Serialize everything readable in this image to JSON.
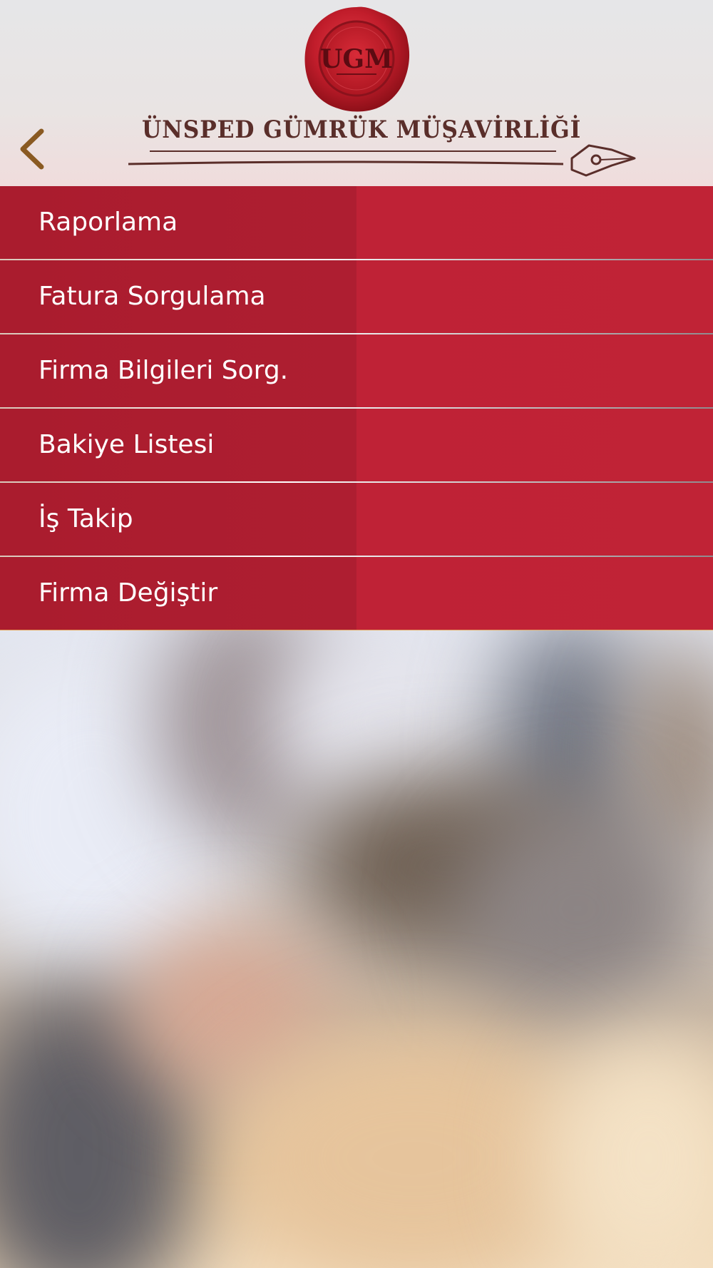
{
  "header": {
    "seal_text": "UGM",
    "brand_title": "ÜNSPED GÜMRÜK MÜŞAVİRLİĞİ"
  },
  "menu": {
    "items": [
      {
        "label": "Raporlama"
      },
      {
        "label": "Fatura Sorgulama"
      },
      {
        "label": "Firma Bilgileri Sorg."
      },
      {
        "label": "Bakiye Listesi"
      },
      {
        "label": "İş Takip"
      },
      {
        "label": "Firma Değiştir"
      }
    ]
  },
  "icons": {
    "back": "chevron-left-icon",
    "pen": "fountain-pen-icon",
    "seal": "wax-seal-logo"
  },
  "colors": {
    "menu_red": "#c02336",
    "menu_red_dark": "#aa1c2e",
    "brand_brown": "#5a2e2a",
    "back_arrow": "#8a5a22"
  }
}
